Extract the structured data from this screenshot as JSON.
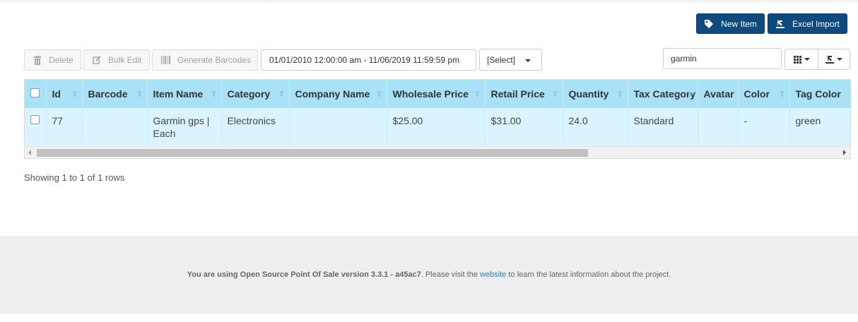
{
  "header": {
    "new_item_label": "New Item",
    "excel_import_label": "Excel Import"
  },
  "toolbar": {
    "delete_label": "Delete",
    "bulk_edit_label": "Bulk Edit",
    "generate_barcodes_label": "Generate Barcodes",
    "date_range": "01/01/2010 12:00:00 am - 11/06/2019 11:59:59 pm",
    "filter_select": "[Select]",
    "search_value": "garmin"
  },
  "table": {
    "columns": [
      "Id",
      "Barcode",
      "Item Name",
      "Category",
      "Company Name",
      "Wholesale Price",
      "Retail Price",
      "Quantity",
      "Tax Category",
      "Avatar",
      "Color",
      "Tag Color"
    ],
    "rows": [
      {
        "id": "77",
        "barcode": "",
        "item_name": "Garmin gps | Each",
        "category": "Electronics",
        "company_name": "",
        "wholesale_price": "$25.00",
        "retail_price": "$31.00",
        "quantity": "24.0",
        "tax_category": "Standard",
        "avatar": "",
        "color": "-",
        "tag_color": "green"
      }
    ]
  },
  "pagination": {
    "info": "Showing 1 to 1 of 1 rows"
  },
  "footer": {
    "prefix": "You are using Open Source Point Of Sale version 3.3.1 - a45ac7",
    "middle": ". Please visit the ",
    "link": "website",
    "suffix": " to learn the latest information about the project."
  },
  "colors": {
    "primary_button": "#0e4a7e",
    "table_header": "#a9e1f6",
    "table_row": "#d9f4fc",
    "footer_bg": "#eeeeee",
    "link": "#2a7ec4"
  }
}
